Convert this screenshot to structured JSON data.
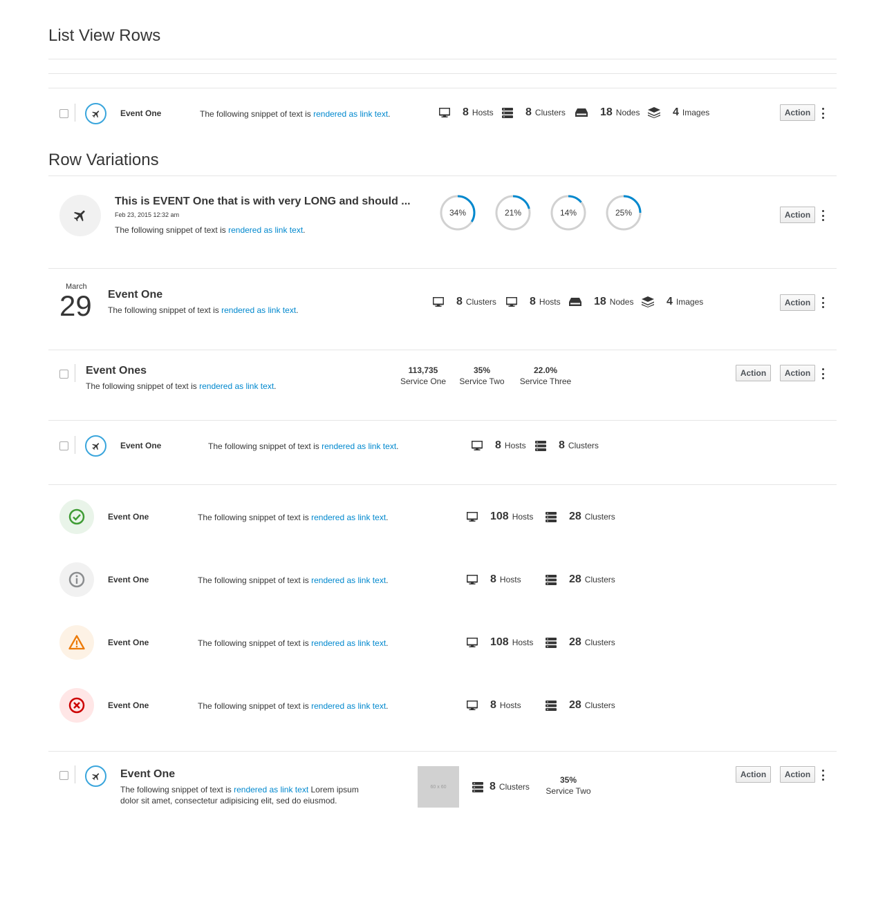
{
  "headings": {
    "list_view_rows": "List View Rows",
    "row_variations": "Row Variations"
  },
  "colors": {
    "accent": "#0088ce",
    "success": "#3f9c35",
    "info": "#8b8d8f",
    "warning": "#ec7a08",
    "danger": "#cc0000",
    "blue_ring": "#39a5dc"
  },
  "snippet": {
    "before": "The following snippet of text is ",
    "link": "rendered as link text",
    "after": "."
  },
  "action_label": "Action",
  "row1": {
    "title": "Event One",
    "items": [
      {
        "icon": "monitor-icon",
        "num": "8",
        "label": "Hosts"
      },
      {
        "icon": "server-icon",
        "num": "8",
        "label": "Clusters"
      },
      {
        "icon": "container-node-icon",
        "num": "18",
        "label": "Nodes"
      },
      {
        "icon": "image-layers-icon",
        "num": "4",
        "label": "Images"
      }
    ]
  },
  "row2": {
    "title": "This is EVENT One that is with very LONG and should ...",
    "timestamp": "Feb 23, 2015 12:32 am",
    "donuts": [
      {
        "label": "34%",
        "value": 34
      },
      {
        "label": "21%",
        "value": 21
      },
      {
        "label": "14%",
        "value": 14
      },
      {
        "label": "25%",
        "value": 25
      }
    ]
  },
  "row3": {
    "month": "March",
    "day": "29",
    "title": "Event One",
    "items": [
      {
        "icon": "monitor-icon",
        "num": "8",
        "label": "Clusters"
      },
      {
        "icon": "monitor-icon",
        "num": "8",
        "label": "Hosts"
      },
      {
        "icon": "container-node-icon",
        "num": "18",
        "label": "Nodes"
      },
      {
        "icon": "image-layers-icon",
        "num": "4",
        "label": "Images"
      }
    ]
  },
  "row4": {
    "title": "Event Ones",
    "stats": [
      {
        "value": "113,735",
        "label": "Service One"
      },
      {
        "value": "35%",
        "label": "Service Two"
      },
      {
        "value": "22.0%",
        "label": "Service Three"
      }
    ]
  },
  "row5": {
    "title": "Event One",
    "items": [
      {
        "icon": "monitor-icon",
        "num": "8",
        "label": "Hosts"
      },
      {
        "icon": "server-icon",
        "num": "8",
        "label": "Clusters"
      }
    ]
  },
  "status_rows": [
    {
      "status": "success",
      "title": "Event One",
      "hosts": "108",
      "hosts_label": "Hosts",
      "clusters": "28",
      "clusters_label": "Clusters"
    },
    {
      "status": "info",
      "title": "Event One",
      "hosts": "8",
      "hosts_label": "Hosts",
      "clusters": "28",
      "clusters_label": "Clusters"
    },
    {
      "status": "warning",
      "title": "Event One",
      "hosts": "108",
      "hosts_label": "Hosts",
      "clusters": "28",
      "clusters_label": "Clusters"
    },
    {
      "status": "danger",
      "title": "Event One",
      "hosts": "8",
      "hosts_label": "Hosts",
      "clusters": "28",
      "clusters_label": "Clusters"
    }
  ],
  "row_last": {
    "title": "Event One",
    "extra_text": " Lorem ipsum",
    "line2": "dolor sit amet, consectetur adipisicing elit, sed do eiusmod.",
    "thumb_label": "60 x 60",
    "clusters_num": "8",
    "clusters_label": "Clusters",
    "stat_value": "35%",
    "stat_label": "Service Two"
  }
}
